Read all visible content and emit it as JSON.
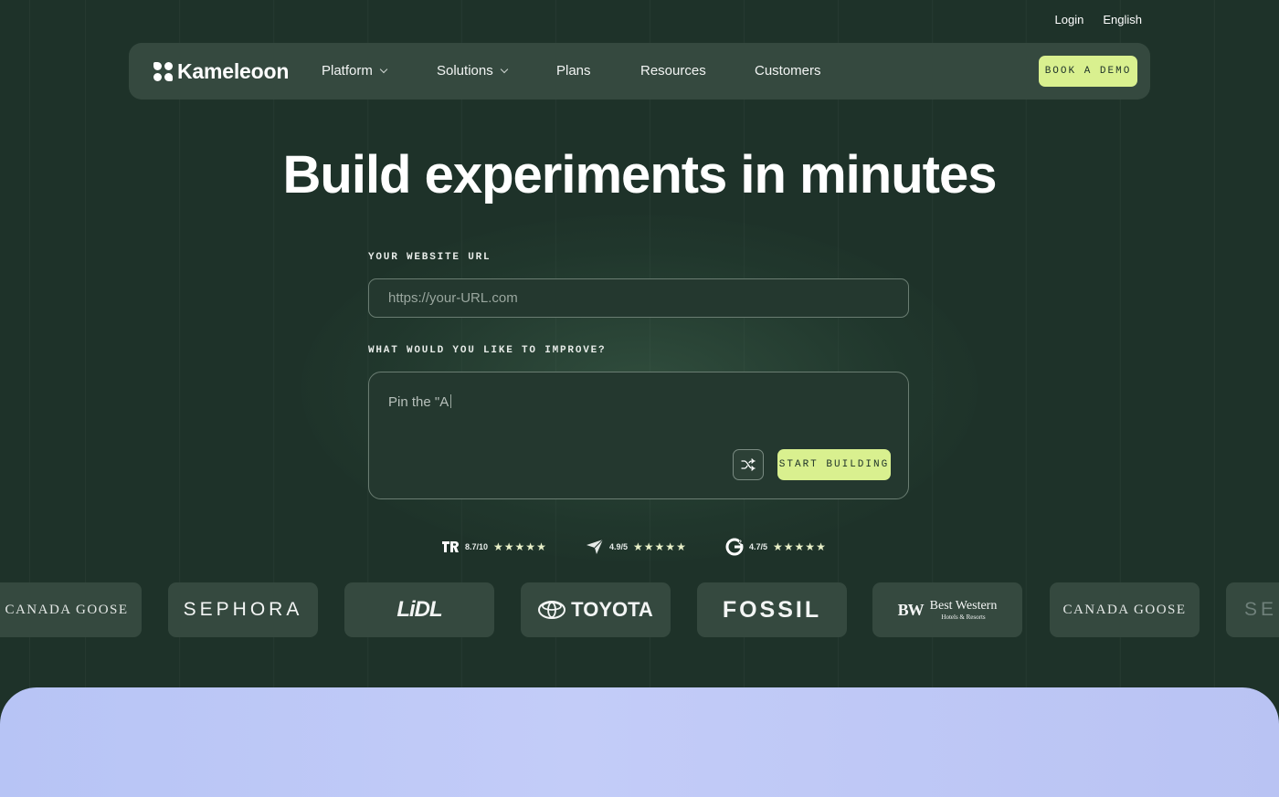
{
  "topbar": {
    "login": "Login",
    "language": "English"
  },
  "nav": {
    "brand": "Kameleoon",
    "items": [
      {
        "label": "Platform",
        "has_dropdown": true
      },
      {
        "label": "Solutions",
        "has_dropdown": true
      },
      {
        "label": "Plans",
        "has_dropdown": false
      },
      {
        "label": "Resources",
        "has_dropdown": false
      },
      {
        "label": "Customers",
        "has_dropdown": false
      }
    ],
    "cta": "BOOK A DEMO"
  },
  "hero": {
    "title": "Build experiments in minutes"
  },
  "form": {
    "url_label": "YOUR WEBSITE URL",
    "url_placeholder": "https://your-URL.com",
    "url_value": "",
    "improve_label": "WHAT WOULD YOU LIKE TO IMPROVE?",
    "improve_text": "Pin the \"A",
    "shuffle_icon": "shuffle-icon",
    "start_button": "START BUILDING"
  },
  "ratings": [
    {
      "icon": "trustradius-icon",
      "score": "8.7/10",
      "stars": "★★★★★"
    },
    {
      "icon": "capterra-icon",
      "score": "4.9/5",
      "stars": "★★★★★"
    },
    {
      "icon": "g2-icon",
      "score": "4.7/5",
      "stars": "★★★★★"
    }
  ],
  "logos": {
    "canada_goose": "CANADA GOOSE",
    "sephora": "SEPHORA",
    "lidl": "LiDL",
    "toyota": "TOYOTA",
    "fossil": "FOSSIL",
    "bw_mark": "BW",
    "bw_name": "Best Western",
    "bw_sub": "Hotels & Resorts",
    "sephora_partial": "SE"
  },
  "colors": {
    "background": "#1e3229",
    "nav_bg": "#35493f",
    "accent": "#d9f08f",
    "bottom_panel": "#c3ccf8"
  }
}
